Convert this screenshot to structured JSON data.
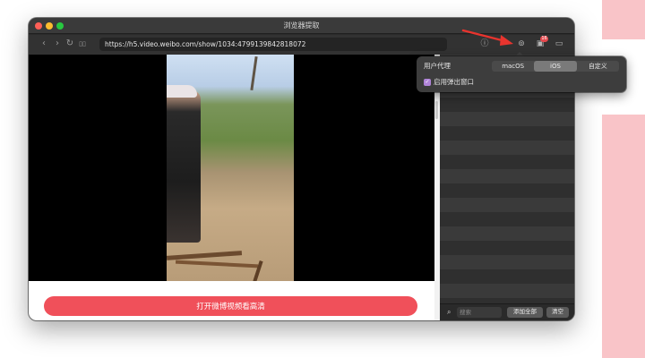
{
  "window": {
    "title": "浏览器提取"
  },
  "toolbar": {
    "back_icon": "‹",
    "forward_icon": "›",
    "reload_icon": "↻",
    "bookmarks_icon": "▯▯",
    "url": "https://h5.video.weibo.com/show/1034:4799139842818072",
    "info_icon": "ⓘ",
    "ua_icon": "⊚",
    "media_icon": "▣",
    "media_badge": "16",
    "sidebar_icon": "▭"
  },
  "content": {
    "cta_label": "打开微博视频看高清"
  },
  "panel": {
    "search_placeholder": "搜索",
    "search_icon": "⌕",
    "add_all_label": "添加全部",
    "clear_label": "清空"
  },
  "popover": {
    "user_agent_label": "用户代理",
    "options": [
      "macOS",
      "iOS",
      "自定义"
    ],
    "selected_option": "iOS",
    "popup_checked": true,
    "popup_label": "启用弹出窗口",
    "check_glyph": "✓"
  },
  "colors": {
    "annotation_arrow": "#e8342e",
    "cta": "#f0505a",
    "badge": "#e5484d",
    "checkbox": "#b084d8"
  }
}
